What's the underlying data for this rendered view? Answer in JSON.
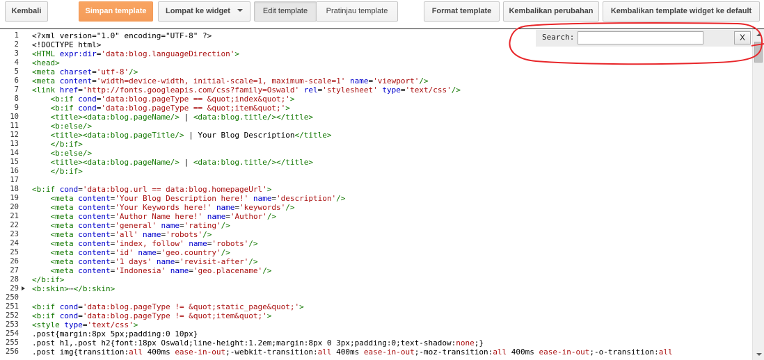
{
  "toolbar": {
    "back_label": "Kembali",
    "save_label": "Simpan template",
    "jump_label": "Lompat ke widget",
    "edit_label": "Edit template",
    "preview_label": "Pratinjau template",
    "format_label": "Format template",
    "revert_label": "Kembalikan perubahan",
    "restore_label": "Kembalikan template widget ke default"
  },
  "search": {
    "label": "Search:",
    "value": "",
    "close_label": "X"
  },
  "colors": {
    "primary": "#f49c5a",
    "tag": "#117700",
    "attribute": "#0000cc",
    "string": "#aa1111",
    "annotation": "#e8262a"
  },
  "editor": {
    "lines": [
      {
        "n": "1",
        "fold": false,
        "tokens": [
          [
            "plain",
            "<?xml version=\"1.0\" encoding=\"UTF-8\" ?>"
          ]
        ]
      },
      {
        "n": "2",
        "fold": false,
        "tokens": [
          [
            "plain",
            "<!DOCTYPE html>"
          ]
        ]
      },
      {
        "n": "3",
        "fold": false,
        "tokens": [
          [
            "tag",
            "<HTML "
          ],
          [
            "attr",
            "expr:dir"
          ],
          [
            "plain",
            "="
          ],
          [
            "str",
            "'data:blog.languageDirection'"
          ],
          [
            "tag",
            ">"
          ]
        ]
      },
      {
        "n": "4",
        "fold": false,
        "tokens": [
          [
            "tag",
            "<head>"
          ]
        ]
      },
      {
        "n": "5",
        "fold": false,
        "tokens": [
          [
            "tag",
            "<meta "
          ],
          [
            "attr",
            "charset"
          ],
          [
            "plain",
            "="
          ],
          [
            "str",
            "'utf-8'"
          ],
          [
            "tag",
            "/>"
          ]
        ]
      },
      {
        "n": "6",
        "fold": false,
        "tokens": [
          [
            "tag",
            "<meta "
          ],
          [
            "attr",
            "content"
          ],
          [
            "plain",
            "="
          ],
          [
            "str",
            "'width=device-width, initial-scale=1, maximum-scale=1'"
          ],
          [
            "plain",
            " "
          ],
          [
            "attr",
            "name"
          ],
          [
            "plain",
            "="
          ],
          [
            "str",
            "'viewport'"
          ],
          [
            "tag",
            "/>"
          ]
        ]
      },
      {
        "n": "7",
        "fold": false,
        "tokens": [
          [
            "tag",
            "<link "
          ],
          [
            "attr",
            "href"
          ],
          [
            "plain",
            "="
          ],
          [
            "str",
            "'http://fonts.googleapis.com/css?family=Oswald'"
          ],
          [
            "plain",
            " "
          ],
          [
            "attr",
            "rel"
          ],
          [
            "plain",
            "="
          ],
          [
            "str",
            "'stylesheet'"
          ],
          [
            "plain",
            " "
          ],
          [
            "attr",
            "type"
          ],
          [
            "plain",
            "="
          ],
          [
            "str",
            "'text/css'"
          ],
          [
            "tag",
            "/>"
          ]
        ]
      },
      {
        "n": "8",
        "fold": false,
        "tokens": [
          [
            "plain",
            "    "
          ],
          [
            "tag",
            "<b:if "
          ],
          [
            "attr",
            "cond"
          ],
          [
            "plain",
            "="
          ],
          [
            "str",
            "'data:blog.pageType == &quot;index&quot;'"
          ],
          [
            "tag",
            ">"
          ]
        ]
      },
      {
        "n": "9",
        "fold": false,
        "tokens": [
          [
            "plain",
            "    "
          ],
          [
            "tag",
            "<b:if "
          ],
          [
            "attr",
            "cond"
          ],
          [
            "plain",
            "="
          ],
          [
            "str",
            "'data:blog.pageType == &quot;item&quot;'"
          ],
          [
            "tag",
            ">"
          ]
        ]
      },
      {
        "n": "10",
        "fold": false,
        "tokens": [
          [
            "plain",
            "    "
          ],
          [
            "tag",
            "<title><data:blog.pageName/>"
          ],
          [
            "plain",
            " | "
          ],
          [
            "tag",
            "<data:blog.title/></title>"
          ]
        ]
      },
      {
        "n": "11",
        "fold": false,
        "tokens": [
          [
            "plain",
            "    "
          ],
          [
            "tag",
            "<b:else/>"
          ]
        ]
      },
      {
        "n": "12",
        "fold": false,
        "tokens": [
          [
            "plain",
            "    "
          ],
          [
            "tag",
            "<title><data:blog.pageTitle/>"
          ],
          [
            "plain",
            " | Your Blog Description"
          ],
          [
            "tag",
            "</title>"
          ]
        ]
      },
      {
        "n": "13",
        "fold": false,
        "tokens": [
          [
            "plain",
            "    "
          ],
          [
            "tag",
            "</b:if>"
          ]
        ]
      },
      {
        "n": "14",
        "fold": false,
        "tokens": [
          [
            "plain",
            "    "
          ],
          [
            "tag",
            "<b:else/>"
          ]
        ]
      },
      {
        "n": "15",
        "fold": false,
        "tokens": [
          [
            "plain",
            "    "
          ],
          [
            "tag",
            "<title><data:blog.pageName/>"
          ],
          [
            "plain",
            " | "
          ],
          [
            "tag",
            "<data:blog.title/></title>"
          ]
        ]
      },
      {
        "n": "16",
        "fold": false,
        "tokens": [
          [
            "plain",
            "    "
          ],
          [
            "tag",
            "</b:if>"
          ]
        ]
      },
      {
        "n": "17",
        "fold": false,
        "tokens": [
          [
            "plain",
            ""
          ]
        ]
      },
      {
        "n": "18",
        "fold": false,
        "tokens": [
          [
            "tag",
            "<b:if "
          ],
          [
            "attr",
            "cond"
          ],
          [
            "plain",
            "="
          ],
          [
            "str",
            "'data:blog.url == data:blog.homepageUrl'"
          ],
          [
            "tag",
            ">"
          ]
        ]
      },
      {
        "n": "19",
        "fold": false,
        "tokens": [
          [
            "plain",
            "    "
          ],
          [
            "tag",
            "<meta "
          ],
          [
            "attr",
            "content"
          ],
          [
            "plain",
            "="
          ],
          [
            "str",
            "'Your Blog Description here!'"
          ],
          [
            "plain",
            " "
          ],
          [
            "attr",
            "name"
          ],
          [
            "plain",
            "="
          ],
          [
            "str",
            "'description'"
          ],
          [
            "tag",
            "/>"
          ]
        ]
      },
      {
        "n": "20",
        "fold": false,
        "tokens": [
          [
            "plain",
            "    "
          ],
          [
            "tag",
            "<meta "
          ],
          [
            "attr",
            "content"
          ],
          [
            "plain",
            "="
          ],
          [
            "str",
            "'Your Keywords here!'"
          ],
          [
            "plain",
            " "
          ],
          [
            "attr",
            "name"
          ],
          [
            "plain",
            "="
          ],
          [
            "str",
            "'keywords'"
          ],
          [
            "tag",
            "/>"
          ]
        ]
      },
      {
        "n": "21",
        "fold": false,
        "tokens": [
          [
            "plain",
            "    "
          ],
          [
            "tag",
            "<meta "
          ],
          [
            "attr",
            "content"
          ],
          [
            "plain",
            "="
          ],
          [
            "str",
            "'Author Name here!'"
          ],
          [
            "plain",
            " "
          ],
          [
            "attr",
            "name"
          ],
          [
            "plain",
            "="
          ],
          [
            "str",
            "'Author'"
          ],
          [
            "tag",
            "/>"
          ]
        ]
      },
      {
        "n": "22",
        "fold": false,
        "tokens": [
          [
            "plain",
            "    "
          ],
          [
            "tag",
            "<meta "
          ],
          [
            "attr",
            "content"
          ],
          [
            "plain",
            "="
          ],
          [
            "str",
            "'general'"
          ],
          [
            "plain",
            " "
          ],
          [
            "attr",
            "name"
          ],
          [
            "plain",
            "="
          ],
          [
            "str",
            "'rating'"
          ],
          [
            "tag",
            "/>"
          ]
        ]
      },
      {
        "n": "23",
        "fold": false,
        "tokens": [
          [
            "plain",
            "    "
          ],
          [
            "tag",
            "<meta "
          ],
          [
            "attr",
            "content"
          ],
          [
            "plain",
            "="
          ],
          [
            "str",
            "'all'"
          ],
          [
            "plain",
            " "
          ],
          [
            "attr",
            "name"
          ],
          [
            "plain",
            "="
          ],
          [
            "str",
            "'robots'"
          ],
          [
            "tag",
            "/>"
          ]
        ]
      },
      {
        "n": "24",
        "fold": false,
        "tokens": [
          [
            "plain",
            "    "
          ],
          [
            "tag",
            "<meta "
          ],
          [
            "attr",
            "content"
          ],
          [
            "plain",
            "="
          ],
          [
            "str",
            "'index, follow'"
          ],
          [
            "plain",
            " "
          ],
          [
            "attr",
            "name"
          ],
          [
            "plain",
            "="
          ],
          [
            "str",
            "'robots'"
          ],
          [
            "tag",
            "/>"
          ]
        ]
      },
      {
        "n": "25",
        "fold": false,
        "tokens": [
          [
            "plain",
            "    "
          ],
          [
            "tag",
            "<meta "
          ],
          [
            "attr",
            "content"
          ],
          [
            "plain",
            "="
          ],
          [
            "str",
            "'id'"
          ],
          [
            "plain",
            " "
          ],
          [
            "attr",
            "name"
          ],
          [
            "plain",
            "="
          ],
          [
            "str",
            "'geo.country'"
          ],
          [
            "tag",
            "/>"
          ]
        ]
      },
      {
        "n": "26",
        "fold": false,
        "tokens": [
          [
            "plain",
            "    "
          ],
          [
            "tag",
            "<meta "
          ],
          [
            "attr",
            "content"
          ],
          [
            "plain",
            "="
          ],
          [
            "str",
            "'1 days'"
          ],
          [
            "plain",
            " "
          ],
          [
            "attr",
            "name"
          ],
          [
            "plain",
            "="
          ],
          [
            "str",
            "'revisit-after'"
          ],
          [
            "tag",
            "/>"
          ]
        ]
      },
      {
        "n": "27",
        "fold": false,
        "tokens": [
          [
            "plain",
            "    "
          ],
          [
            "tag",
            "<meta "
          ],
          [
            "attr",
            "content"
          ],
          [
            "plain",
            "="
          ],
          [
            "str",
            "'Indonesia'"
          ],
          [
            "plain",
            " "
          ],
          [
            "attr",
            "name"
          ],
          [
            "plain",
            "="
          ],
          [
            "str",
            "'geo.placename'"
          ],
          [
            "tag",
            "/>"
          ]
        ]
      },
      {
        "n": "28",
        "fold": false,
        "tokens": [
          [
            "tag",
            "</b:if>"
          ]
        ]
      },
      {
        "n": "29",
        "fold": true,
        "tokens": [
          [
            "tag",
            "<b:skin>"
          ],
          [
            "ell",
            "⋯"
          ],
          [
            "tag",
            "</b:skin>"
          ]
        ]
      },
      {
        "n": "250",
        "fold": false,
        "tokens": [
          [
            "plain",
            ""
          ]
        ]
      },
      {
        "n": "251",
        "fold": false,
        "tokens": [
          [
            "tag",
            "<b:if "
          ],
          [
            "attr",
            "cond"
          ],
          [
            "plain",
            "="
          ],
          [
            "str",
            "'data:blog.pageType != &quot;static_page&quot;'"
          ],
          [
            "tag",
            ">"
          ]
        ]
      },
      {
        "n": "252",
        "fold": false,
        "tokens": [
          [
            "tag",
            "<b:if "
          ],
          [
            "attr",
            "cond"
          ],
          [
            "plain",
            "="
          ],
          [
            "str",
            "'data:blog.pageType != &quot;item&quot;'"
          ],
          [
            "tag",
            ">"
          ]
        ]
      },
      {
        "n": "253",
        "fold": false,
        "tokens": [
          [
            "tag",
            "<style "
          ],
          [
            "attr",
            "type"
          ],
          [
            "plain",
            "="
          ],
          [
            "str",
            "'text/css'"
          ],
          [
            "tag",
            ">"
          ]
        ]
      },
      {
        "n": "254",
        "fold": false,
        "tokens": [
          [
            "plain",
            ".post{margin:8px 5px;padding:0 10px}"
          ]
        ]
      },
      {
        "n": "255",
        "fold": false,
        "tokens": [
          [
            "plain",
            ".post h1,.post h2{font:18px Oswald;line-height:1.2em;margin:8px 0 3px;padding:0;text-shadow:"
          ],
          [
            "kw",
            "none"
          ],
          [
            "plain",
            ";}"
          ]
        ]
      },
      {
        "n": "256",
        "fold": false,
        "tokens": [
          [
            "plain",
            ".post img{transition:"
          ],
          [
            "kw",
            "all"
          ],
          [
            "plain",
            " 400ms "
          ],
          [
            "kw",
            "ease-in-out"
          ],
          [
            "plain",
            ";-webkit-transition:"
          ],
          [
            "kw",
            "all"
          ],
          [
            "plain",
            " 400ms "
          ],
          [
            "kw",
            "ease-in-out"
          ],
          [
            "plain",
            ";-moz-transition:"
          ],
          [
            "kw",
            "all"
          ],
          [
            "plain",
            " 400ms "
          ],
          [
            "kw",
            "ease-in-out"
          ],
          [
            "plain",
            ";-o-transition:"
          ],
          [
            "kw",
            "all"
          ]
        ]
      }
    ]
  }
}
